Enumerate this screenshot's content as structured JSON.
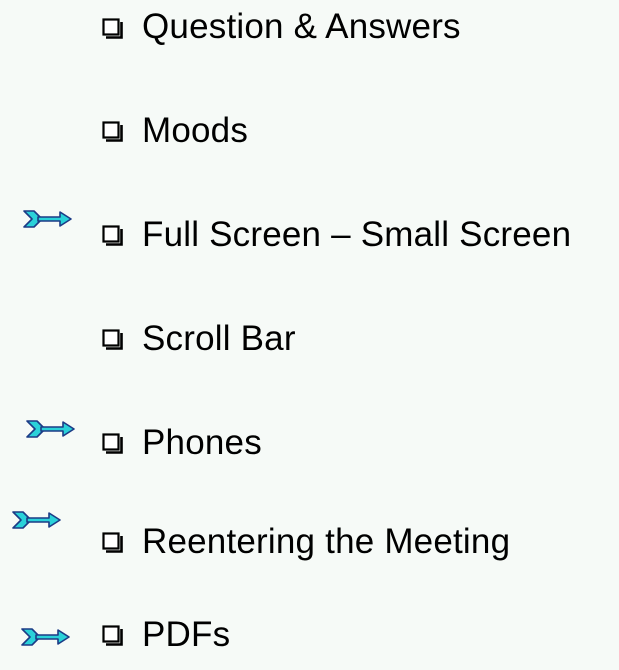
{
  "colors": {
    "background": "#f6faf7",
    "arrow_fill": "#2ad1d9",
    "arrow_outline": "#1c3b86",
    "checkbox_stroke": "#000000"
  },
  "icons": {
    "checkbox": "square-checkbox-icon",
    "marker": "double-arrow-icon"
  },
  "items": [
    {
      "label": "Question & Answers",
      "marked": false
    },
    {
      "label": "Moods",
      "marked": false
    },
    {
      "label": "Full Screen – Small Screen",
      "marked": true
    },
    {
      "label": "Scroll Bar",
      "marked": false
    },
    {
      "label": "Phones",
      "marked": true
    },
    {
      "label": "Reentering the Meeting",
      "marked": true
    },
    {
      "label": "PDFs",
      "marked": true
    }
  ]
}
